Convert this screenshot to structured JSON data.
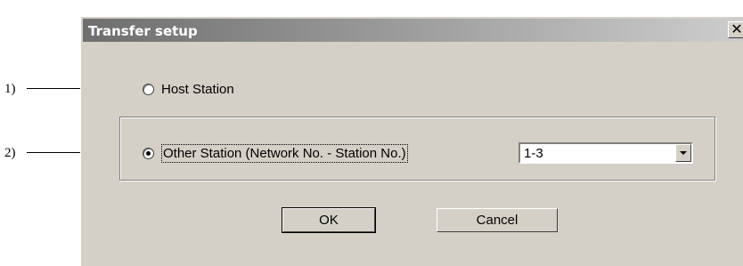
{
  "annotations": {
    "label_1": "1)",
    "label_2": "2)"
  },
  "dialog": {
    "title": "Transfer setup",
    "close_glyph": "✕"
  },
  "options": {
    "host_station": {
      "label": "Host Station",
      "selected": false
    },
    "other_station": {
      "label": "Other Station (Network No. - Station No.)",
      "selected": true
    }
  },
  "station_select": {
    "value": "1-3",
    "icon": "chevron-down-icon"
  },
  "buttons": {
    "ok": "OK",
    "cancel": "Cancel"
  }
}
